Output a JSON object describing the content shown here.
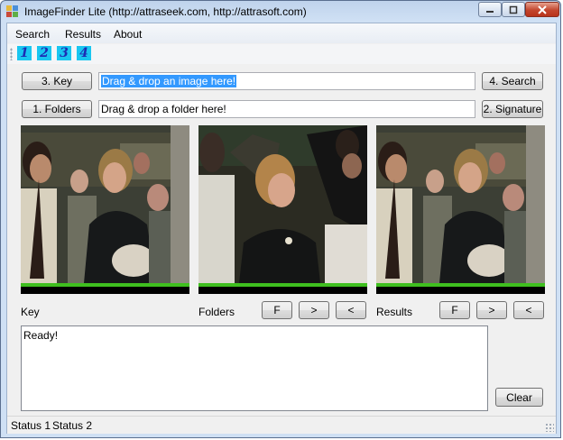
{
  "window": {
    "title": "ImageFinder Lite (http://attraseek.com, http://attrasoft.com)"
  },
  "menu": [
    "Search",
    "Results",
    "About"
  ],
  "toolbar": [
    "1",
    "2",
    "3",
    "4"
  ],
  "row1": {
    "key_button": "3. Key",
    "key_field_value": "Drag & drop an image here!",
    "search_button": "4. Search"
  },
  "row2": {
    "folders_button": "1. Folders",
    "folder_field_value": "Drag & drop a folder here!",
    "signature_button": "2. Signature"
  },
  "panels": {
    "key_label": "Key",
    "folders_label": "Folders",
    "results_label": "Results",
    "first_button": "F",
    "next_button": ">",
    "prev_button": "<"
  },
  "log": {
    "text": "Ready!"
  },
  "clear_button": "Clear",
  "status": [
    "Status 1",
    "Status 2"
  ]
}
